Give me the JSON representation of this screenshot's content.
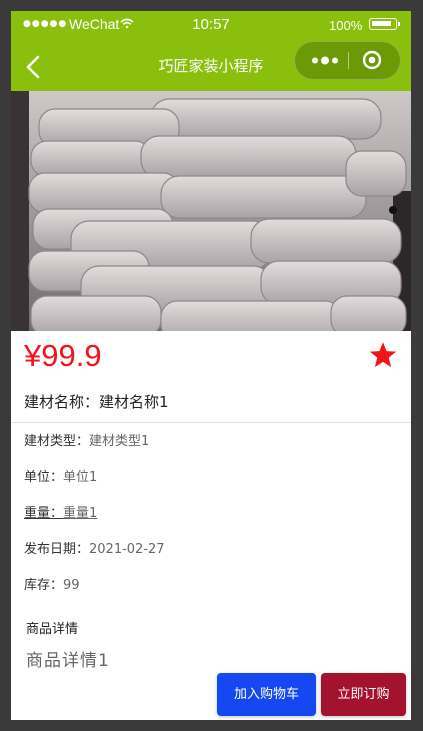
{
  "status_bar": {
    "signal": "●●●●●",
    "carrier": "WeChat",
    "time": "10:57",
    "battery": "100%"
  },
  "nav": {
    "title": "巧匠家装小程序"
  },
  "product": {
    "price": "¥99.9",
    "name_label": "建材名称：",
    "name_value": "建材名称1",
    "attributes": [
      {
        "label": "建材类型：",
        "value": "建材类型1"
      },
      {
        "label": "单位：",
        "value": "单位1"
      },
      {
        "label": "重量：",
        "value": "重量1"
      },
      {
        "label": "发布日期：",
        "value": "2021-02-27"
      },
      {
        "label": "库存：",
        "value": "99"
      }
    ],
    "detail_title": "商品详情",
    "detail_text": "商品详情1"
  },
  "actions": {
    "add_to_cart": "加入购物车",
    "buy_now": "立即订购"
  },
  "colors": {
    "header": "#8bbf0e",
    "price": "#f2131b",
    "cart_button": "#1548f2",
    "buy_button": "#a3122f",
    "favorite": "#f2131b"
  },
  "icons": {
    "back": "chevron-left-icon",
    "more": "more-dots-icon",
    "close": "target-close-icon",
    "favorite": "star-icon"
  }
}
